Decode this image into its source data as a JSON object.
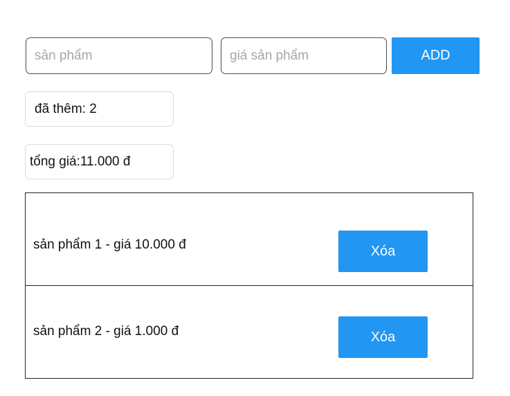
{
  "form": {
    "product_placeholder": "sản phẩm",
    "price_placeholder": "giá sản phẩm",
    "add_label": "ADD"
  },
  "summary": {
    "added_text": "đã thêm: 2",
    "total_text": "tổng giá:11.000 đ"
  },
  "items": [
    {
      "text": "sản phẩm 1 - giá 10.000 đ",
      "delete_label": "Xóa"
    },
    {
      "text": "sản phẩm 2 - giá 1.000 đ",
      "delete_label": "Xóa"
    }
  ],
  "colors": {
    "accent": "#2196f3",
    "button_text": "#ffffff",
    "list_border": "#222222"
  }
}
